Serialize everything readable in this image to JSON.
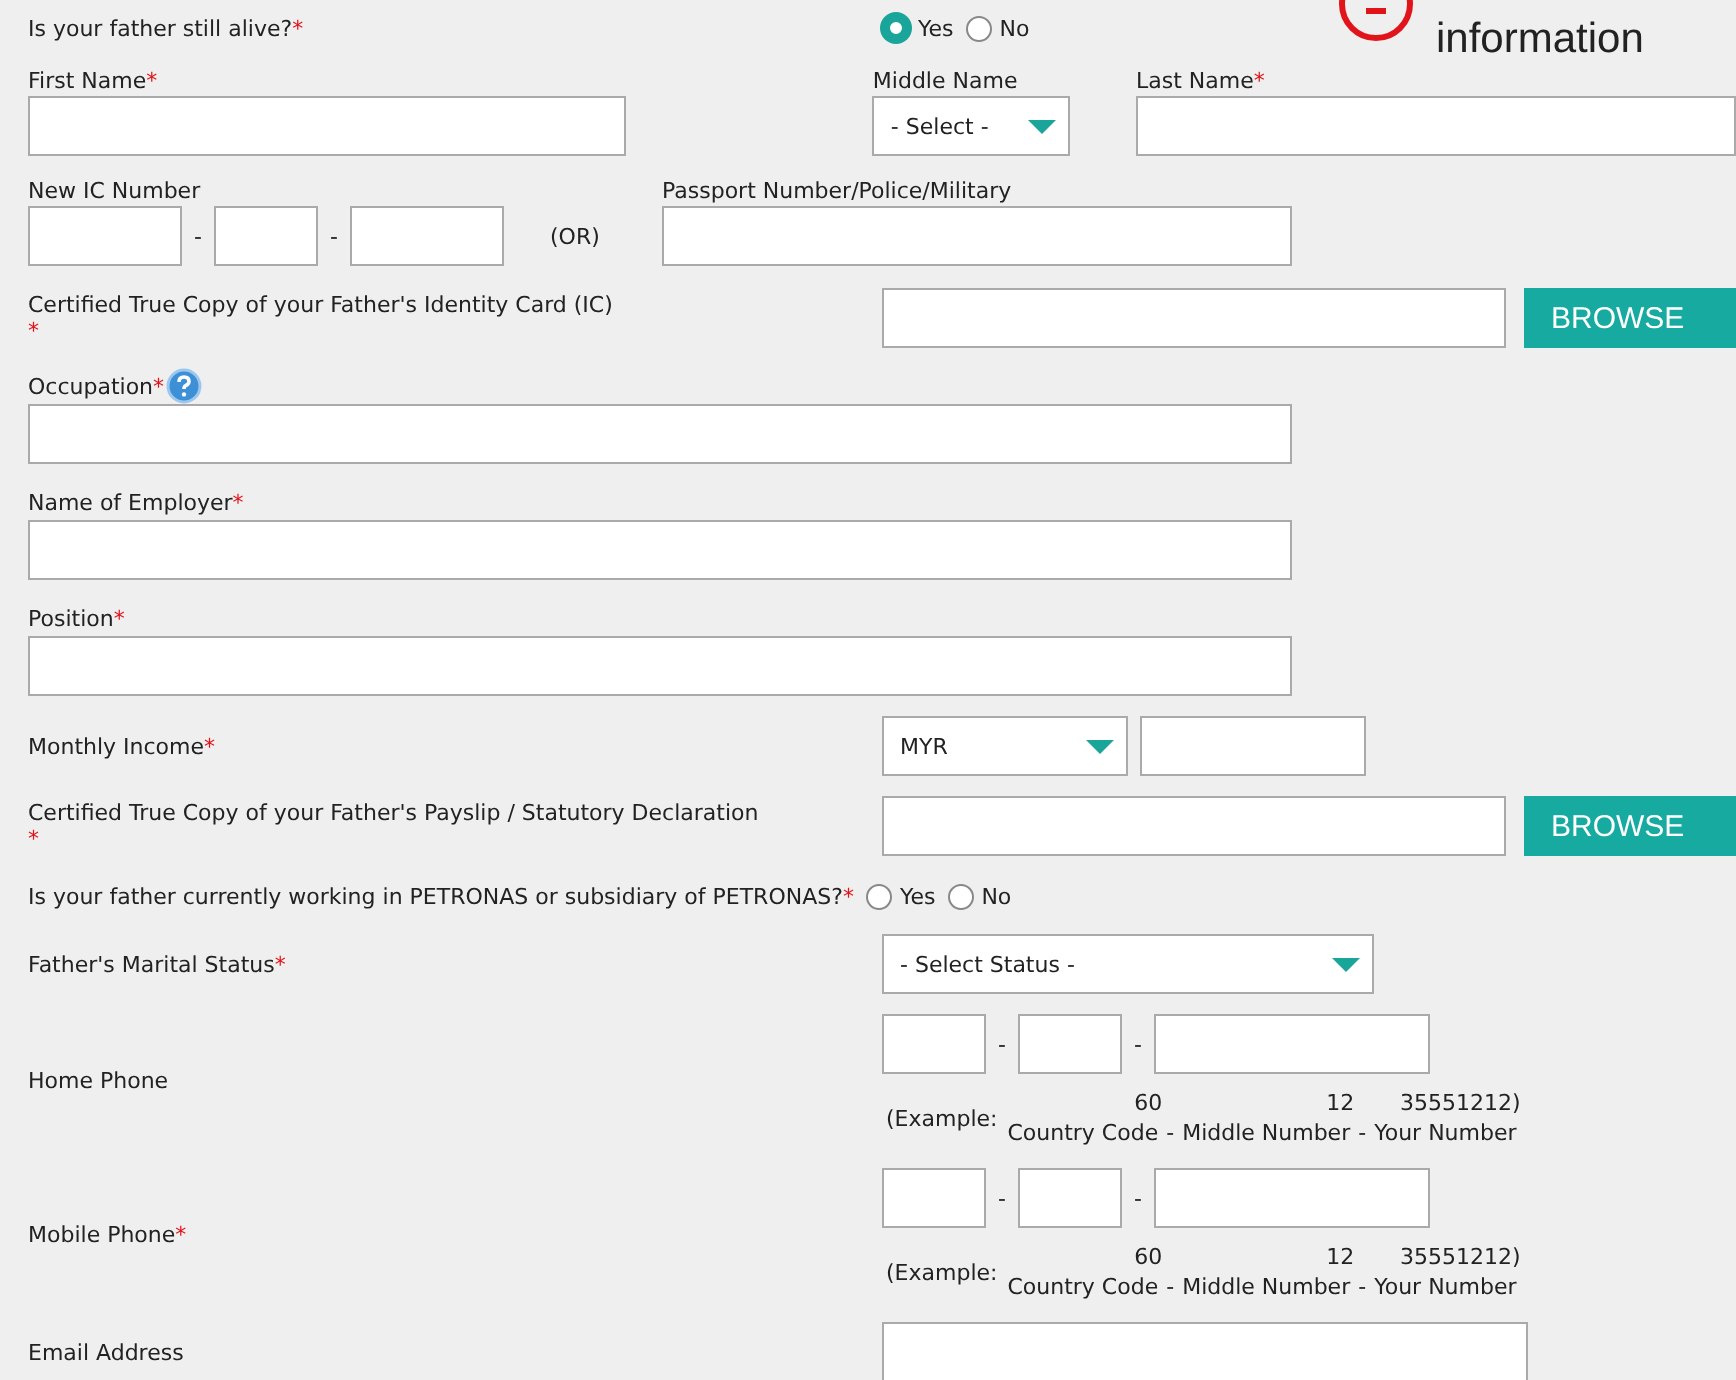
{
  "callout": {
    "text": "information"
  },
  "father_alive": {
    "label": "Is your father still alive?",
    "required_mark": "*",
    "options": [
      {
        "label": "Yes",
        "selected": true
      },
      {
        "label": "No",
        "selected": false
      }
    ]
  },
  "name_fields": [
    {
      "kind": "text",
      "label": "First Name",
      "required_mark": "*"
    },
    {
      "kind": "select",
      "label": "Middle Name",
      "value": "- Select -"
    },
    {
      "kind": "text",
      "label": "Last Name",
      "required_mark": "*"
    }
  ],
  "ic": {
    "label": "New IC Number",
    "separators": [
      "-",
      "-"
    ],
    "or_text": "(OR)",
    "passport_label": "Passport Number/Police/Military"
  },
  "form_rows": [
    {
      "kind": "upload",
      "label": "Certified True Copy of your Father's Identity Card (IC)",
      "required_mark": "*",
      "button": "BROWSE"
    },
    {
      "kind": "stacked",
      "label": "Occupation",
      "required_mark": "*",
      "help": true
    },
    {
      "kind": "stacked",
      "label": "Name of Employer",
      "required_mark": "*"
    },
    {
      "kind": "stacked",
      "label": "Position",
      "required_mark": "*"
    },
    {
      "kind": "currency",
      "label": "Monthly Income",
      "required_mark": "*",
      "value": "MYR"
    },
    {
      "kind": "upload",
      "label": "Certified True Copy of your Father's Payslip / Statutory Declaration",
      "required_mark": "*",
      "button": "BROWSE"
    },
    {
      "kind": "radio",
      "label": "Is your father currently working in PETRONAS or subsidiary of PETRONAS?",
      "required_mark": "*",
      "options": [
        {
          "label": "Yes",
          "selected": false
        },
        {
          "label": "No",
          "selected": false
        }
      ]
    },
    {
      "kind": "select",
      "label": "Father's Marital Status",
      "required_mark": "*",
      "value": "- Select Status -"
    },
    {
      "kind": "phone",
      "label": "Home Phone",
      "separators": [
        "-",
        "-"
      ],
      "example": {
        "prefix": "(Example:",
        "parts": [
          {
            "value": "60",
            "caption": "Country Code"
          },
          {
            "caption": "-"
          },
          {
            "value": "12",
            "caption": "Middle Number"
          },
          {
            "caption": "-"
          },
          {
            "value": "35551212)",
            "caption": "Your Number"
          }
        ]
      }
    },
    {
      "kind": "phone",
      "label": "Mobile Phone",
      "required_mark": "*",
      "separators": [
        "-",
        "-"
      ],
      "example": {
        "prefix": "(Example:",
        "parts": [
          {
            "value": "60",
            "caption": "Country Code"
          },
          {
            "caption": "-"
          },
          {
            "value": "12",
            "caption": "Middle Number"
          },
          {
            "caption": "-"
          },
          {
            "value": "35551212)",
            "caption": "Your Number"
          }
        ]
      }
    },
    {
      "kind": "text",
      "label": "Email Address"
    }
  ]
}
